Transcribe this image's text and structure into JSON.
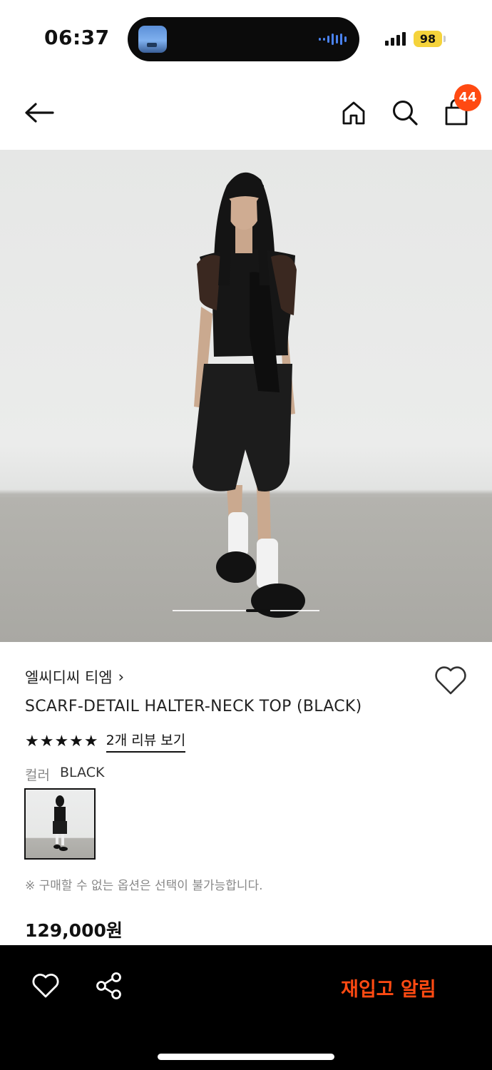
{
  "status_bar": {
    "time": "06:37",
    "battery": "98",
    "icons": [
      "now-playing-thumbnail",
      "audio-waveform-icon",
      "cellular-signal-icon",
      "battery-icon"
    ]
  },
  "nav": {
    "icons": [
      "back-arrow-icon",
      "home-icon",
      "search-icon",
      "shopping-bag-icon"
    ],
    "cart_count": "44"
  },
  "gallery": {
    "image_alt": "model wearing black scarf-detail halter-neck top",
    "total_slides": 6,
    "current_slide": 4
  },
  "product": {
    "brand": "엘씨디씨 티엠",
    "name": "SCARF-DETAIL HALTER-NECK TOP (BLACK)",
    "stars": "★★★★★",
    "rating": 5,
    "review_link": "2개 리뷰 보기",
    "color_label": "컬러",
    "color_value": "BLACK",
    "notice": "※ 구매할 수 없는 옵션은 선택이 불가능합니다.",
    "price": "129,000원"
  },
  "bottom_bar": {
    "icons": [
      "heart-icon",
      "share-icon"
    ],
    "restock_label": "재입고 알림"
  },
  "colors": {
    "accent": "#ff4a12",
    "battery": "#f5d33b",
    "bottom_bar": "#000000"
  }
}
